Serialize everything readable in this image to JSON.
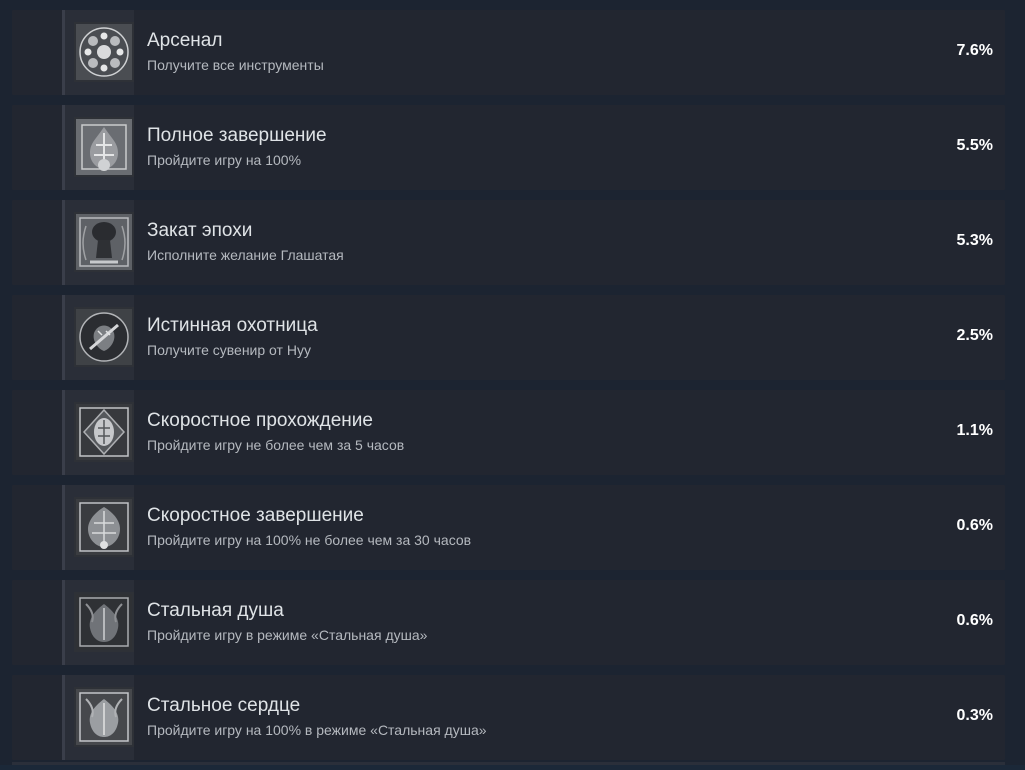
{
  "achievements": [
    {
      "title": "Арсенал",
      "description": "Получите все инструменты",
      "percent": "7.6%",
      "icon": "arsenal-tools-icon"
    },
    {
      "title": "Полное завершение",
      "description": "Пройдите игру на 100%",
      "percent": "5.5%",
      "icon": "full-completion-icon"
    },
    {
      "title": "Закат эпохи",
      "description": "Исполните желание Глашатая",
      "percent": "5.3%",
      "icon": "herald-icon"
    },
    {
      "title": "Истинная охотница",
      "description": "Получите сувенир от Нуу",
      "percent": "2.5%",
      "icon": "true-huntress-icon"
    },
    {
      "title": "Скоростное прохождение",
      "description": "Пройдите игру не более чем за 5 часов",
      "percent": "1.1%",
      "icon": "speedrun-icon"
    },
    {
      "title": "Скоростное завершение",
      "description": "Пройдите игру на 100% не более чем за 30 часов",
      "percent": "0.6%",
      "icon": "speed-completion-icon"
    },
    {
      "title": "Стальная душа",
      "description": "Пройдите игру в режиме «Стальная душа»",
      "percent": "0.6%",
      "icon": "steel-soul-icon"
    },
    {
      "title": "Стальное сердце",
      "description": "Пройдите игру на 100% в режиме «Стальная душа»",
      "percent": "0.3%",
      "icon": "steel-heart-icon"
    }
  ]
}
